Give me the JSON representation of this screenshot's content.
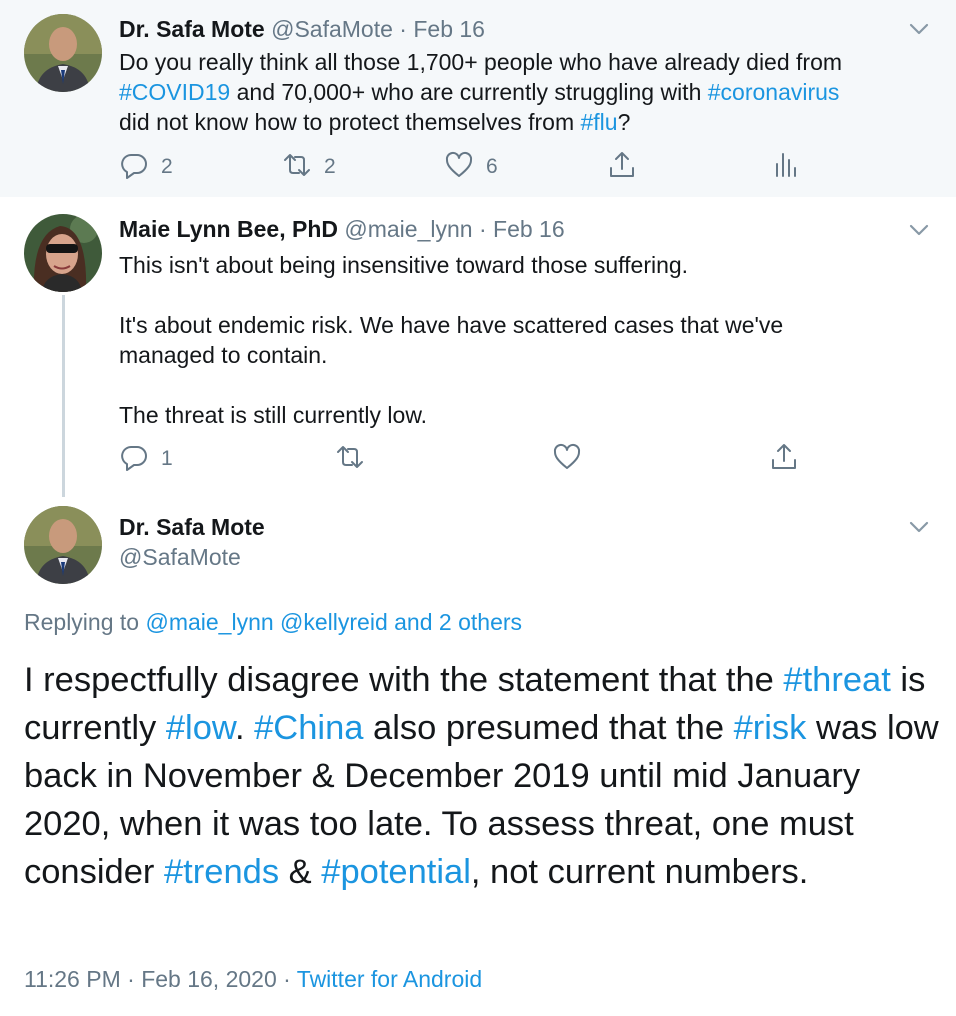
{
  "tweet1": {
    "name": "Dr. Safa Mote",
    "handle": "@SafaMote",
    "separator": "·",
    "date": "Feb 16",
    "text": {
      "p1": "Do you really think all those 1,700+ people who have already died from",
      "tag1": "#COVID19",
      "p2": " and 70,000+ who are currently struggling with ",
      "tag2": "#coronavirus",
      "p3": "did not know how to protect themselves from ",
      "tag3": "#flu",
      "p4": "?"
    },
    "actions": {
      "replies": "2",
      "retweets": "2",
      "likes": "6"
    }
  },
  "tweet2": {
    "name": "Maie Lynn Bee, PhD",
    "handle": "@maie_lynn",
    "separator": "·",
    "date": "Feb 16",
    "paragraphs": [
      "This isn't about being insensitive toward those suffering.",
      "It's about endemic risk. We have have scattered cases that we've managed to contain.",
      "The threat is still currently low."
    ],
    "actions": {
      "replies": "1"
    }
  },
  "tweet3": {
    "name": "Dr. Safa Mote",
    "handle": "@SafaMote",
    "replying_prefix": "Replying to ",
    "replying_users": "@maie_lynn @kellyreid and 2 others",
    "text": {
      "s1": "I respectfully disagree with the statement that the ",
      "tag_threat": "#threat",
      "s2": " is currently ",
      "tag_low": "#low",
      "s3": ". ",
      "tag_china": "#China",
      "s4": " also presumed that the ",
      "tag_risk": "#risk",
      "s5": " was low back in November & December 2019 until mid January 2020, when it was too late. To assess threat, one must consider ",
      "tag_trends": "#trends",
      "s6": " & ",
      "tag_potential": "#potential",
      "s7": ", not current numbers."
    },
    "time": "11:26 PM",
    "separator": " · ",
    "full_date": "Feb 16, 2020",
    "source": "Twitter for Android"
  },
  "colors": {
    "link": "#1b95e0",
    "muted": "#657786",
    "highlight_bg": "#f5f8fa",
    "thread_line": "#ccd6dd"
  },
  "icons": [
    "chevron-down-icon",
    "reply-icon",
    "retweet-icon",
    "like-icon",
    "share-icon",
    "analytics-icon"
  ]
}
